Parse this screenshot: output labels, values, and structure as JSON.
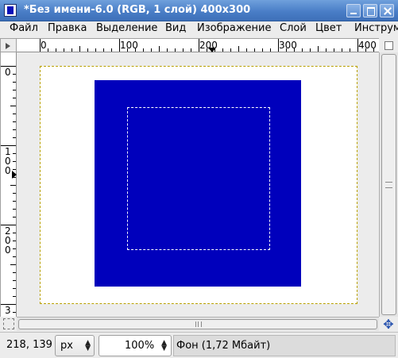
{
  "window": {
    "title": "*Без имени-6.0 (RGB, 1 слой) 400x300"
  },
  "menu": [
    {
      "label": "Файл"
    },
    {
      "label": "Правка"
    },
    {
      "label": "Выделение"
    },
    {
      "label": "Вид"
    },
    {
      "label": "Изображение"
    },
    {
      "label": "Слой"
    },
    {
      "label": "Цвет"
    },
    {
      "label": "Инструм"
    }
  ],
  "rulers": {
    "horizontal": [
      "0",
      "100",
      "200",
      "300",
      "400"
    ],
    "vertical": [
      "0",
      "100",
      "200",
      "3"
    ]
  },
  "canvas": {
    "foreground_color": "#0000bc",
    "background_color": "#ffffff"
  },
  "status": {
    "coords": "218, 139",
    "unit": "px",
    "zoom": "100%",
    "message": "Фон (1,72 Мбайт)"
  }
}
